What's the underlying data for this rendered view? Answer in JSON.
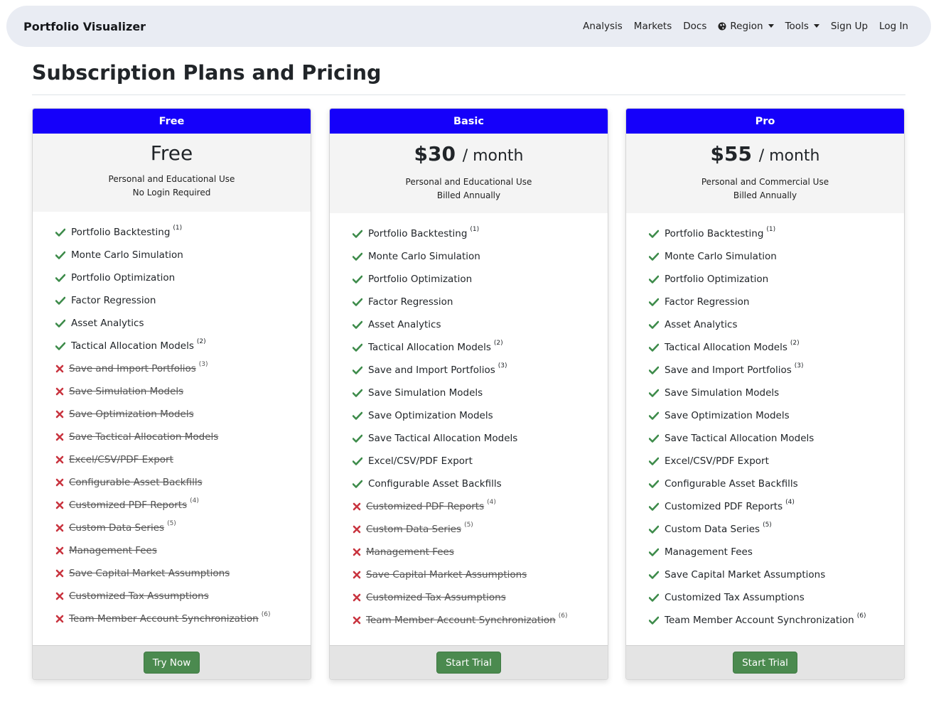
{
  "nav": {
    "brand": "Portfolio Visualizer",
    "links": {
      "analysis": "Analysis",
      "markets": "Markets",
      "docs": "Docs",
      "region": "Region",
      "tools": "Tools",
      "signup": "Sign Up",
      "login": "Log In"
    }
  },
  "page": {
    "title": "Subscription Plans and Pricing"
  },
  "colors": {
    "header": "#1500fa",
    "check": "#3d8b4a",
    "cross": "#c9343f",
    "button": "#4b8a4f"
  },
  "plans": [
    {
      "name": "Free",
      "price": "Free",
      "per": "",
      "desc1": "Personal and Educational Use",
      "desc2": "No Login Required",
      "button": "Try Now",
      "features": [
        {
          "label": "Portfolio Backtesting",
          "note": "(1)",
          "on": true
        },
        {
          "label": "Monte Carlo Simulation",
          "note": "",
          "on": true
        },
        {
          "label": "Portfolio Optimization",
          "note": "",
          "on": true
        },
        {
          "label": "Factor Regression",
          "note": "",
          "on": true
        },
        {
          "label": "Asset Analytics",
          "note": "",
          "on": true
        },
        {
          "label": "Tactical Allocation Models",
          "note": "(2)",
          "on": true
        },
        {
          "label": "Save and Import Portfolios",
          "note": "(3)",
          "on": false
        },
        {
          "label": "Save Simulation Models",
          "note": "",
          "on": false
        },
        {
          "label": "Save Optimization Models",
          "note": "",
          "on": false
        },
        {
          "label": "Save Tactical Allocation Models",
          "note": "",
          "on": false
        },
        {
          "label": "Excel/CSV/PDF Export",
          "note": "",
          "on": false
        },
        {
          "label": "Configurable Asset Backfills",
          "note": "",
          "on": false
        },
        {
          "label": "Customized PDF Reports",
          "note": "(4)",
          "on": false
        },
        {
          "label": "Custom Data Series",
          "note": "(5)",
          "on": false
        },
        {
          "label": "Management Fees",
          "note": "",
          "on": false
        },
        {
          "label": "Save Capital Market Assumptions",
          "note": "",
          "on": false
        },
        {
          "label": "Customized Tax Assumptions",
          "note": "",
          "on": false
        },
        {
          "label": "Team Member Account Synchronization",
          "note": "(6)",
          "on": false
        }
      ]
    },
    {
      "name": "Basic",
      "price": "$30",
      "per": "/ month",
      "desc1": "Personal and Educational Use",
      "desc2": "Billed Annually",
      "button": "Start Trial",
      "features": [
        {
          "label": "Portfolio Backtesting",
          "note": "(1)",
          "on": true
        },
        {
          "label": "Monte Carlo Simulation",
          "note": "",
          "on": true
        },
        {
          "label": "Portfolio Optimization",
          "note": "",
          "on": true
        },
        {
          "label": "Factor Regression",
          "note": "",
          "on": true
        },
        {
          "label": "Asset Analytics",
          "note": "",
          "on": true
        },
        {
          "label": "Tactical Allocation Models",
          "note": "(2)",
          "on": true
        },
        {
          "label": "Save and Import Portfolios",
          "note": "(3)",
          "on": true
        },
        {
          "label": "Save Simulation Models",
          "note": "",
          "on": true
        },
        {
          "label": "Save Optimization Models",
          "note": "",
          "on": true
        },
        {
          "label": "Save Tactical Allocation Models",
          "note": "",
          "on": true
        },
        {
          "label": "Excel/CSV/PDF Export",
          "note": "",
          "on": true
        },
        {
          "label": "Configurable Asset Backfills",
          "note": "",
          "on": true
        },
        {
          "label": "Customized PDF Reports",
          "note": "(4)",
          "on": false
        },
        {
          "label": "Custom Data Series",
          "note": "(5)",
          "on": false
        },
        {
          "label": "Management Fees",
          "note": "",
          "on": false
        },
        {
          "label": "Save Capital Market Assumptions",
          "note": "",
          "on": false
        },
        {
          "label": "Customized Tax Assumptions",
          "note": "",
          "on": false
        },
        {
          "label": "Team Member Account Synchronization",
          "note": "(6)",
          "on": false
        }
      ]
    },
    {
      "name": "Pro",
      "price": "$55",
      "per": "/ month",
      "desc1": "Personal and Commercial Use",
      "desc2": "Billed Annually",
      "button": "Start Trial",
      "features": [
        {
          "label": "Portfolio Backtesting",
          "note": "(1)",
          "on": true
        },
        {
          "label": "Monte Carlo Simulation",
          "note": "",
          "on": true
        },
        {
          "label": "Portfolio Optimization",
          "note": "",
          "on": true
        },
        {
          "label": "Factor Regression",
          "note": "",
          "on": true
        },
        {
          "label": "Asset Analytics",
          "note": "",
          "on": true
        },
        {
          "label": "Tactical Allocation Models",
          "note": "(2)",
          "on": true
        },
        {
          "label": "Save and Import Portfolios",
          "note": "(3)",
          "on": true
        },
        {
          "label": "Save Simulation Models",
          "note": "",
          "on": true
        },
        {
          "label": "Save Optimization Models",
          "note": "",
          "on": true
        },
        {
          "label": "Save Tactical Allocation Models",
          "note": "",
          "on": true
        },
        {
          "label": "Excel/CSV/PDF Export",
          "note": "",
          "on": true
        },
        {
          "label": "Configurable Asset Backfills",
          "note": "",
          "on": true
        },
        {
          "label": "Customized PDF Reports",
          "note": "(4)",
          "on": true
        },
        {
          "label": "Custom Data Series",
          "note": "(5)",
          "on": true
        },
        {
          "label": "Management Fees",
          "note": "",
          "on": true
        },
        {
          "label": "Save Capital Market Assumptions",
          "note": "",
          "on": true
        },
        {
          "label": "Customized Tax Assumptions",
          "note": "",
          "on": true
        },
        {
          "label": "Team Member Account Synchronization",
          "note": "(6)",
          "on": true
        }
      ]
    }
  ]
}
